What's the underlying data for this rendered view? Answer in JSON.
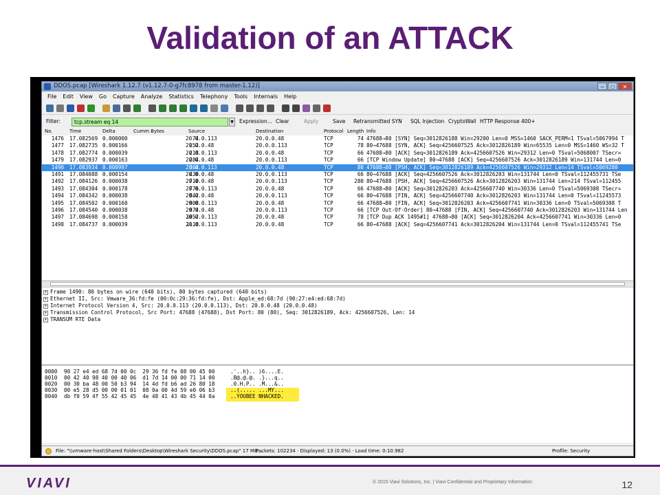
{
  "slide": {
    "title": "Validation of an ATTACK",
    "copyright": "© 2015 Viavi Solutions, Inc. | Viavi Confidential and Proprietary Information",
    "page_number": "12",
    "logo": "VIAVI"
  },
  "window": {
    "title": "DDOS.pcap   [Wireshark 1.12.7 (v1.12.7-0-g7fc8978 from master-1.12)]",
    "controls": {
      "minimize": "–",
      "maximize": "□",
      "close": "✕"
    }
  },
  "menu": [
    "File",
    "Edit",
    "View",
    "Go",
    "Capture",
    "Analyze",
    "Statistics",
    "Telephony",
    "Tools",
    "Internals",
    "Help"
  ],
  "filter": {
    "label": "Filter:",
    "value": "tcp.stream eq 14",
    "buttons": [
      "Expression...",
      "Clear",
      "Apply",
      "Save"
    ],
    "bookmarks": [
      "Retransmitted SYN",
      "SQL Injection",
      "CryptoWall",
      "HTTP Response 400+"
    ]
  },
  "columns": [
    "No.",
    "Time",
    "Delta",
    "Cumm Bytes",
    "Source",
    "Destination",
    "Protocol",
    "Length",
    "Info"
  ],
  "packets": [
    {
      "no": "1476",
      "time": "17.082569",
      "delta": "0.000000",
      "cumm": "74",
      "src": "20.0.0.113",
      "dst": "20.0.0.48",
      "proto": "TCP",
      "len": "74",
      "info": "47688→80 [SYN] Seq=3012826188 Win=29200 Len=0 MSS=1460 SACK_PERM=1 TSval=5067994 T"
    },
    {
      "no": "1477",
      "time": "17.082735",
      "delta": "0.000166",
      "cumm": "152",
      "src": "20.0.0.48",
      "dst": "20.0.0.113",
      "proto": "TCP",
      "len": "78",
      "info": "80→47688 [SYN, ACK] Seq=4256607525 Ack=3012826189 Win=65535 Len=0 MSS=1460 WS=32 T"
    },
    {
      "no": "1478",
      "time": "17.082774",
      "delta": "0.000039",
      "cumm": "218",
      "src": "20.0.0.113",
      "dst": "20.0.0.48",
      "proto": "TCP",
      "len": "66",
      "info": "47688→80 [ACK] Seq=3012826189 Ack=4256607526 Win=29312 Len=0 TSval=5068007 TSecr="
    },
    {
      "no": "1479",
      "time": "17.082937",
      "delta": "0.000163",
      "cumm": "284",
      "src": "20.0.0.48",
      "dst": "20.0.0.113",
      "proto": "TCP",
      "len": "66",
      "info": "[TCP Window Update] 80→47688 [ACK] Seq=4256607526 Ack=3012826189 Win=131744 Len=0"
    },
    {
      "no": "1490",
      "time": "17.083934",
      "delta": "0.000997",
      "cumm": "364",
      "src": "20.0.0.113",
      "dst": "20.0.0.48",
      "proto": "TCP",
      "len": "80",
      "info": "47688→80 [PSH, ACK] Seq=3012826189 Ack=4256607526 Win=29312 Len=14 TSval=5069280",
      "selected": true
    },
    {
      "no": "1491",
      "time": "17.084088",
      "delta": "0.000154",
      "cumm": "430",
      "src": "20.0.0.48",
      "dst": "20.0.0.113",
      "proto": "TCP",
      "len": "66",
      "info": "80→47688 [ACK] Seq=4256607526 Ack=3012826203 Win=131744 Len=0 TSval=112455731 TSe"
    },
    {
      "no": "1492",
      "time": "17.084126",
      "delta": "0.000038",
      "cumm": "710",
      "src": "20.0.0.48",
      "dst": "20.0.0.113",
      "proto": "TCP",
      "len": "280",
      "info": "80→47688 [PSH, ACK] Seq=4256607526 Ack=3012826203 Win=131744 Len=214 TSval=112455"
    },
    {
      "no": "1493",
      "time": "17.084304",
      "delta": "0.000178",
      "cumm": "776",
      "src": "20.0.0.113",
      "dst": "20.0.0.48",
      "proto": "TCP",
      "len": "66",
      "info": "47688→80 [ACK] Seq=3012826203 Ack=4256607740 Win=30336 Len=0 TSval=5069308 TSecr="
    },
    {
      "no": "1494",
      "time": "17.084342",
      "delta": "0.000038",
      "cumm": "842",
      "src": "20.0.0.48",
      "dst": "20.0.0.113",
      "proto": "TCP",
      "len": "66",
      "info": "80→47688 [FIN, ACK] Seq=4256607740 Ack=3012826203 Win=131744 Len=0 TSval=11245573"
    },
    {
      "no": "1495",
      "time": "17.084502",
      "delta": "0.000160",
      "cumm": "908",
      "src": "20.0.0.113",
      "dst": "20.0.0.48",
      "proto": "TCP",
      "len": "66",
      "info": "47688→80 [FIN, ACK] Seq=3012826203 Ack=4256607741 Win=30336 Len=0 TSval=5069308 T"
    },
    {
      "no": "1496",
      "time": "17.084540",
      "delta": "0.000038",
      "cumm": "974",
      "src": "20.0.0.48",
      "dst": "20.0.0.113",
      "proto": "TCP",
      "len": "66",
      "info": "[TCP Out-Of-Order] 80→47688 [FIN, ACK] Seq=4256607740 Ack=3012826203 Win=131744 Len"
    },
    {
      "no": "1497",
      "time": "17.084698",
      "delta": "0.000158",
      "cumm": "1052",
      "src": "20.0.0.113",
      "dst": "20.0.0.48",
      "proto": "TCP",
      "len": "78",
      "info": "[TCP Dup ACK 1495#1] 47688→80 [ACK] Seq=3012826204 Ack=4256607741 Win=30336 Len=0"
    },
    {
      "no": "1498",
      "time": "17.084737",
      "delta": "0.000039",
      "cumm": "1118",
      "src": "20.0.0.113",
      "dst": "20.0.0.48",
      "proto": "TCP",
      "len": "66",
      "info": "80→47688 [ACK] Seq=4256607741 Ack=3012826204 Win=131744 Len=0 TSval=112455741 TSe"
    }
  ],
  "details": [
    "Frame 1490: 80 bytes on wire (640 bits), 80 bytes captured (640 bits)",
    "Ethernet II, Src: Vmware_36:fd:fe (00:0c:29:36:fd:fe), Dst: Apple_ed:68:7d (90:27:e4:ed:68:7d)",
    "Internet Protocol Version 4, Src: 20.0.0.113 (20.0.0.113), Dst: 20.0.0.48 (20.0.0.48)",
    "Transmission Control Protocol, Src Port: 47688 (47688), Dst Port: 80 (80), Seq: 3012826189, Ack: 4256607526, Len: 14",
    "TRANSUM RTE Data"
  ],
  "hex": [
    {
      "offset": "0000",
      "bytes": "90 27 e4 ed 68 7d 00 0c  29 36 fd fe 08 00 45 00",
      "ascii": ".'..h}.. )6....E."
    },
    {
      "offset": "0010",
      "bytes": "00 42 40 98 40 00 40 06  d1 7d 14 00 00 71 14 00",
      "ascii": ".B@.@.@. .}...q.."
    },
    {
      "offset": "0020",
      "bytes": "00 30 ba 48 00 50 b3 94  14 4d fd b6 ad 26 80 18",
      "ascii": ".0.H.P.. .M...&.."
    },
    {
      "offset": "0030",
      "bytes": "00 e5 28 d5 00 00 01 01  08 0a 00 4d 59 e0 06 b3",
      "ascii": "..(..... ...MY..."
    },
    {
      "offset": "0040",
      "bytes": "db f0 59 4f 55 42 45 45  4e 48 41 43 4b 45 44 0a",
      "ascii": "..YOUBEE NHACKED."
    }
  ],
  "status": {
    "file": "File: \"\\\\vmware-host\\Shared Folders\\Desktop\\Wireshark Security\\DDOS.pcap\" 17 MB ...",
    "packets": "Packets: 102234 · Displayed: 13 (0.0%) · Load time: 0:10.982",
    "profile": "Profile: Security"
  }
}
